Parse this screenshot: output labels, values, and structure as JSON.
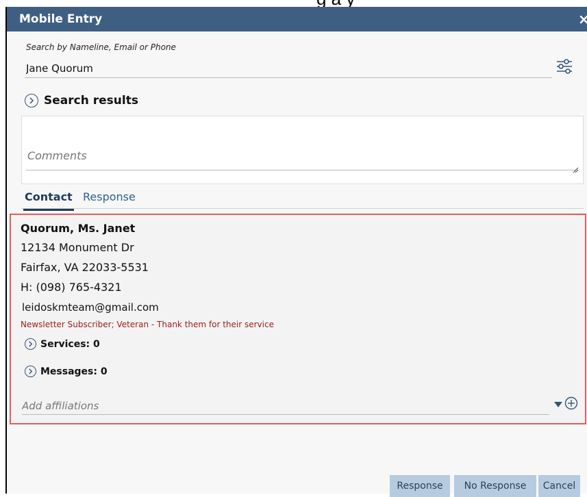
{
  "dialog": {
    "title": "Mobile Entry",
    "close_glyph": "×"
  },
  "search": {
    "label": "Search by Nameline, Email or Phone",
    "value": "Jane Quorum",
    "filter_icon": "sliders-icon"
  },
  "results": {
    "label": "Search results"
  },
  "comments": {
    "placeholder": "Comments"
  },
  "tabs": [
    {
      "label": "Contact",
      "active": true
    },
    {
      "label": "Response",
      "active": false
    }
  ],
  "contact": {
    "name": "Quorum, Ms. Janet",
    "address_line1": "12134 Monument Dr",
    "address_line2": "Fairfax, VA 22033-5531",
    "phone": "H: (098) 765-4321",
    "email": "leidoskmteam@gmail.com",
    "note": "Newsletter Subscriber; Veteran - Thank them for their service",
    "services_label": "Services: 0",
    "messages_label": "Messages: 0",
    "affiliations_placeholder": "Add affiliations"
  },
  "buttons": {
    "response": "Response",
    "no_response": "No Response",
    "cancel": "Cancel"
  },
  "colors": {
    "titlebar": "#3f5f82",
    "highlight_border": "#e25c5c",
    "note_text": "#9b2020",
    "button_bg": "#b6cbe0",
    "accent": "#34557a"
  }
}
